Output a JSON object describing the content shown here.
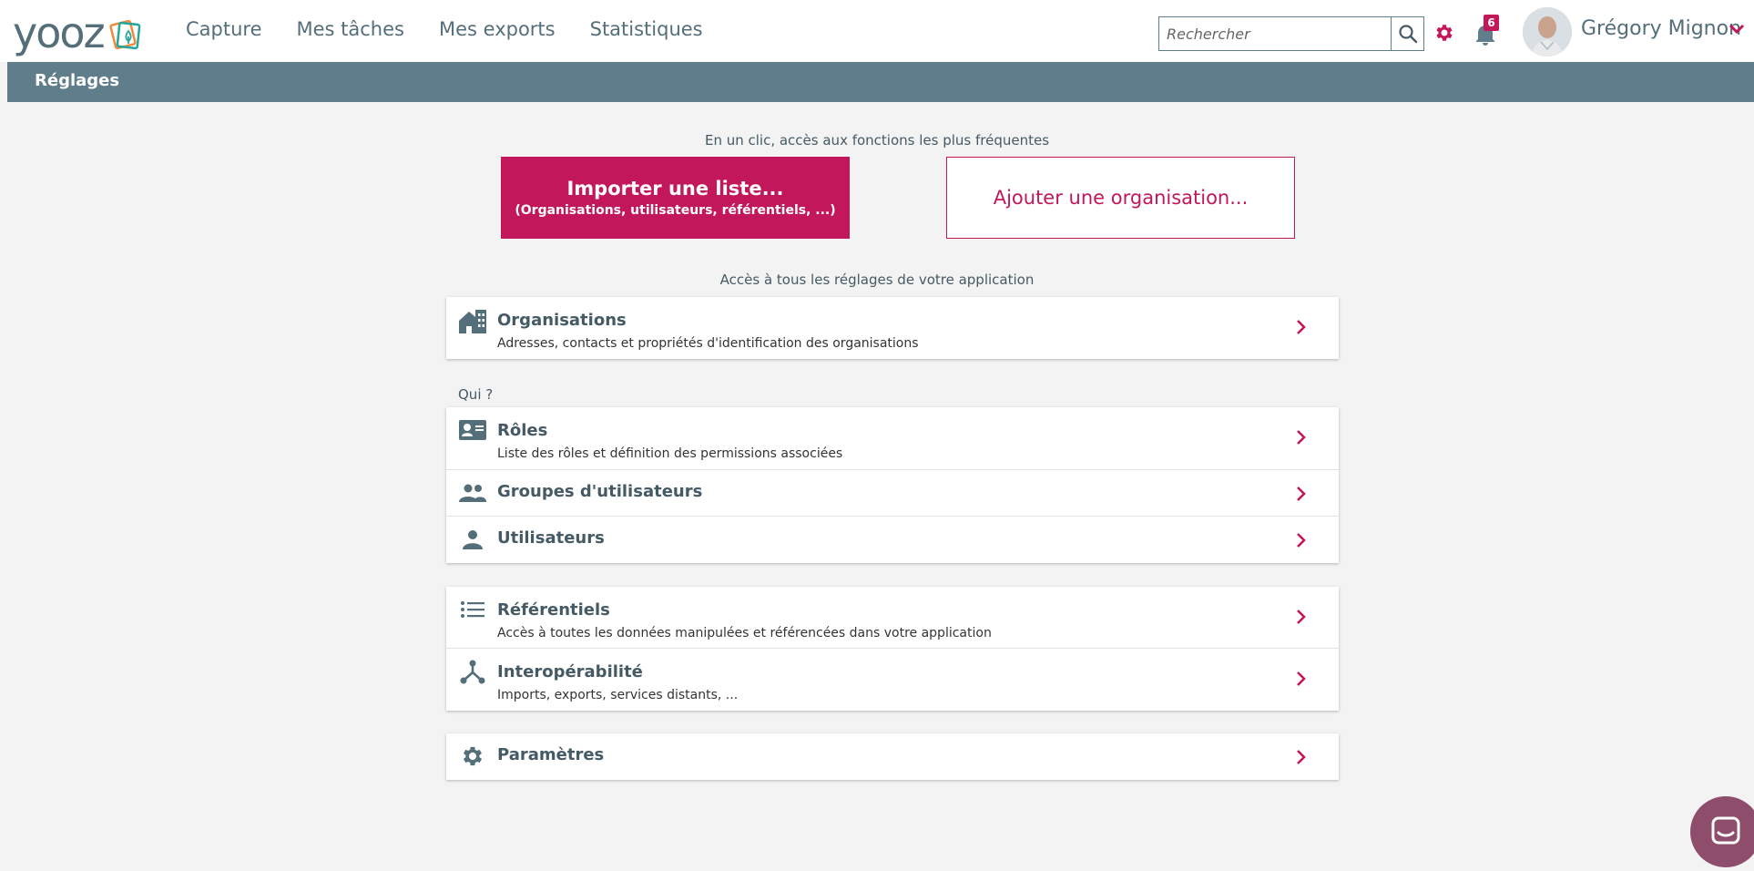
{
  "app": {
    "logo_text": "yooz",
    "brand_color": "#c2185b",
    "primary_color": "#607d8b"
  },
  "nav": {
    "items": [
      {
        "label": "Capture"
      },
      {
        "label": "Mes tâches"
      },
      {
        "label": "Mes exports"
      },
      {
        "label": "Statistiques"
      }
    ]
  },
  "search": {
    "placeholder": "Rechercher",
    "icon": "search-icon"
  },
  "notifications": {
    "count": "6",
    "icon": "bell-icon"
  },
  "user": {
    "name": "Grégory Mignon",
    "icon": "chevron-down-icon"
  },
  "section": {
    "title": "Réglages"
  },
  "quick": {
    "caption": "En un clic, accès aux fonctions les plus fréquentes",
    "import_title": "Importer une liste...",
    "import_subtitle": "(Organisations, utilisateurs, référentiels, ...)",
    "add_org": "Ajouter une organisation..."
  },
  "settings": {
    "caption": "Accès à tous les réglages de votre application",
    "organisations": {
      "title": "Organisations",
      "desc": "Adresses, contacts et propriétés d'identification des organisations",
      "icon": "building-icon"
    },
    "who_label": "Qui ?",
    "roles": {
      "title": "Rôles",
      "desc": "Liste des rôles et définition des permissions associées",
      "icon": "id-card-icon"
    },
    "groups": {
      "title": "Groupes d'utilisateurs",
      "icon": "group-icon"
    },
    "users": {
      "title": "Utilisateurs",
      "icon": "person-icon"
    },
    "referentiels": {
      "title": "Référentiels",
      "desc": "Accès à toutes les données manipulées et référencées dans votre application",
      "icon": "list-icon"
    },
    "interop": {
      "title": "Interopérabilité",
      "desc": "Imports, exports, services distants, ...",
      "icon": "network-icon"
    },
    "parametres": {
      "title": "Paramètres",
      "icon": "gear-icon"
    }
  }
}
